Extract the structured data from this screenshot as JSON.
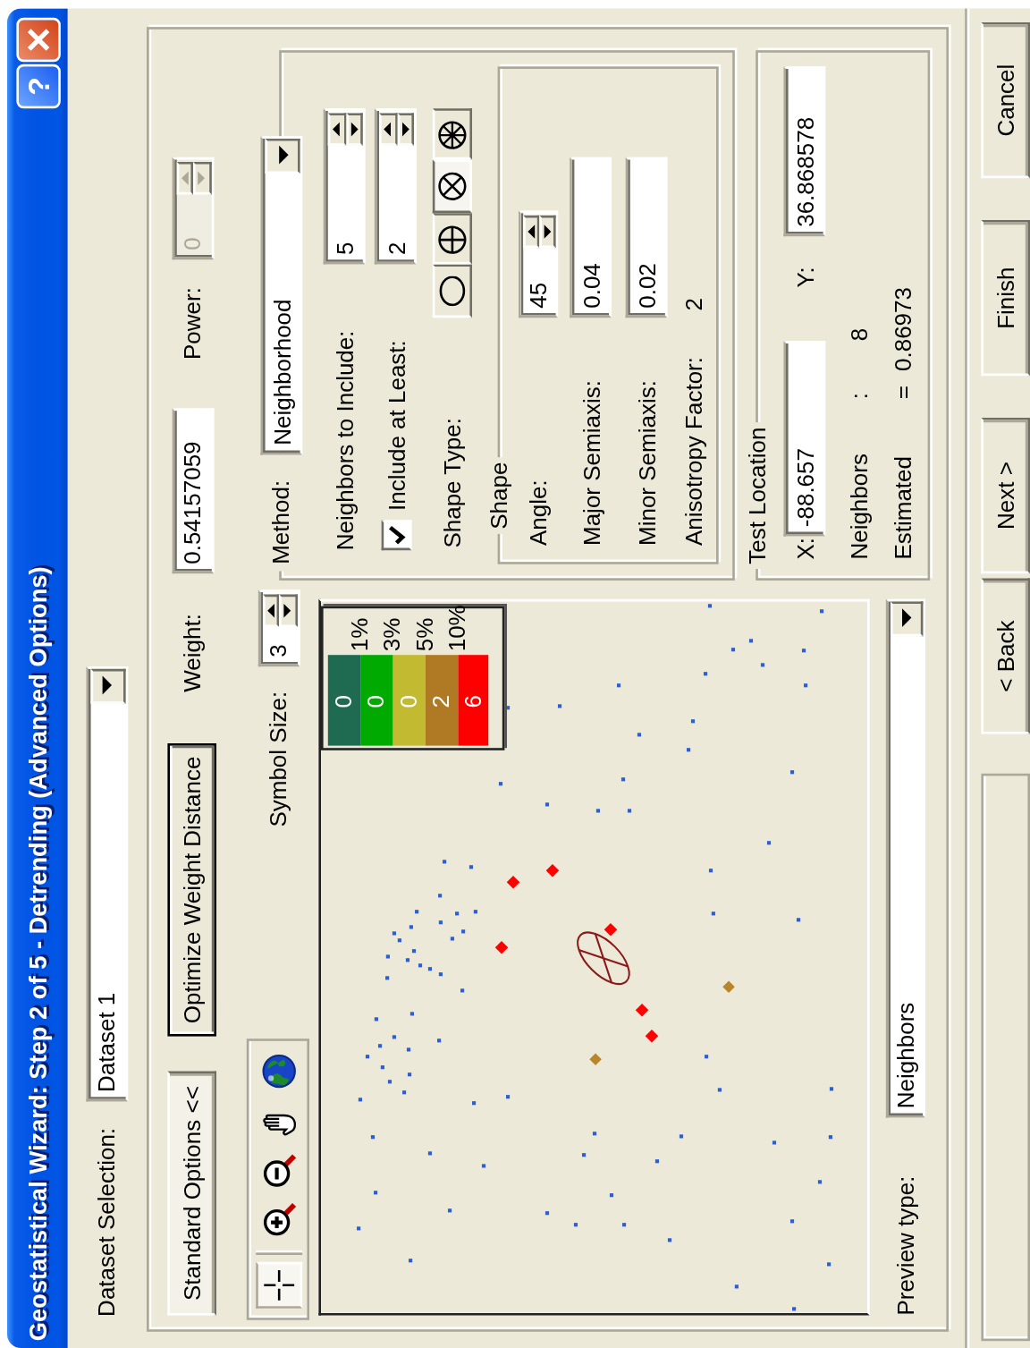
{
  "window": {
    "title": "Geostatistical Wizard: Step 2 of 5 - Detrending (Advanced Options)",
    "help_button": "?"
  },
  "dataset_selection": {
    "label": "Dataset Selection:",
    "value": "Dataset 1"
  },
  "standard_options_button": "Standard Options <<",
  "optimize_button": "Optimize Weight Distance",
  "weight": {
    "label": "Weight:",
    "value": "0.54157059"
  },
  "power": {
    "label": "Power:",
    "value": "0",
    "disabled": true
  },
  "map_tools": [
    {
      "kind": "select",
      "selected": true
    },
    {
      "kind": "zoom_in",
      "selected": false
    },
    {
      "kind": "zoom_out",
      "selected": false
    },
    {
      "kind": "pan",
      "selected": false
    },
    {
      "kind": "full_extent",
      "selected": false
    }
  ],
  "symbol_size": {
    "label": "Symbol Size:",
    "value": "3"
  },
  "map_legend": {
    "bars": [
      {
        "count": "0",
        "color": "#1e6b52"
      },
      {
        "count": "0",
        "color": "#00aa00"
      },
      {
        "count": "0",
        "color": "#c2bb32"
      },
      {
        "count": "2",
        "color": "#b07a24"
      },
      {
        "count": "6",
        "color": "#ff0000"
      }
    ],
    "thresholds": [
      "1%",
      "3%",
      "5%",
      "10%"
    ]
  },
  "preview_type": {
    "label": "Preview type:",
    "value": "Neighbors"
  },
  "method": {
    "label": "Method:",
    "value": "Neighborhood",
    "neighbors_to_include": {
      "label": "Neighbors to Include:",
      "value": "5"
    },
    "include_at_least": {
      "label": "Include at Least:",
      "checked": true,
      "value": "2"
    },
    "shape_type": {
      "label": "Shape Type:",
      "options": [
        {
          "kind": "circle",
          "selected": false
        },
        {
          "kind": "circle_cross",
          "selected": false
        },
        {
          "kind": "circle_x",
          "selected": true
        },
        {
          "kind": "circle_star",
          "selected": false
        }
      ]
    },
    "shape": {
      "title": "Shape",
      "angle": {
        "label": "Angle:",
        "value": "45"
      },
      "major_semiaxis": {
        "label": "Major Semiaxis:",
        "value": "0.04"
      },
      "minor_semiaxis": {
        "label": "Minor Semiaxis:",
        "value": "0.02"
      },
      "anisotropy_factor": {
        "label": "Anisotropy Factor:",
        "value": "2"
      }
    }
  },
  "test_location": {
    "title": "Test Location",
    "x": {
      "label": "X:",
      "value": "-88.657"
    },
    "y": {
      "label": "Y:",
      "value": "36.868578"
    },
    "neighbors": {
      "label": "Neighbors",
      "separator": ":",
      "value": "8"
    },
    "estimated": {
      "label": "Estimated",
      "separator": "=",
      "value": "0.86973"
    }
  },
  "buttons": [
    {
      "label": "< Back"
    },
    {
      "label": "Next >"
    },
    {
      "label": "Finish"
    },
    {
      "label": "Cancel"
    }
  ]
}
